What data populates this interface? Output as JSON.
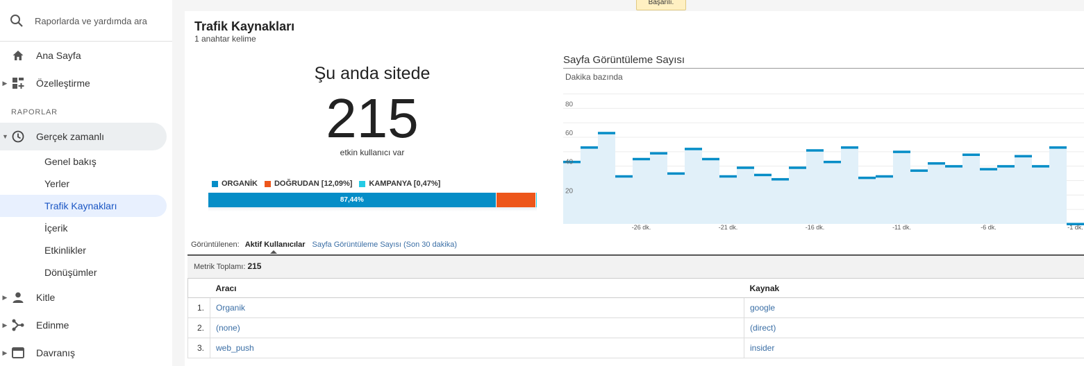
{
  "search": {
    "placeholder": "Raporlarda ve yardımda ara"
  },
  "sidebar": {
    "home": "Ana Sayfa",
    "customize": "Özelleştirme",
    "section": "RAPORLAR",
    "realtime": "Gerçek zamanlı",
    "realtime_items": [
      "Genel bakış",
      "Yerler",
      "Trafik Kaynakları",
      "İçerik",
      "Etkinlikler",
      "Dönüşümler"
    ],
    "audience": "Kitle",
    "acquisition": "Edinme",
    "behavior": "Davranış"
  },
  "toast": "Başarılı.",
  "page": {
    "title": "Trafik Kaynakları",
    "subtitle": "1 anahtar kelime"
  },
  "now": {
    "label": "Şu anda sitede",
    "count": "215",
    "caption": "etkin kullanıcı var"
  },
  "breakdown": {
    "legend": [
      {
        "label": "ORGANİK",
        "color": "#058dc7"
      },
      {
        "label": "DOĞRUDAN [12,09%]",
        "color": "#ed561b"
      },
      {
        "label": "KAMPANYA [0,47%]",
        "color": "#24cbe5"
      }
    ],
    "segments": [
      {
        "percent": 87.44,
        "text": "87,44%",
        "color": "#058dc7"
      },
      {
        "percent": 12.09,
        "text": "",
        "color": "#ed561b"
      },
      {
        "percent": 0.47,
        "text": "",
        "color": "#24cbe5"
      }
    ]
  },
  "chart_data": {
    "type": "bar",
    "title": "Sayfa Görüntüleme Sayısı",
    "subtitle": "Dakika bazında",
    "yticks": [
      20,
      40,
      60,
      80
    ],
    "ylim": [
      0,
      96
    ],
    "x_tick_labels": [
      "-26 dk.",
      "-21 dk.",
      "-16 dk.",
      "-11 dk.",
      "-6 dk.",
      "-1 dk."
    ],
    "x_tick_positions": [
      -26,
      -21,
      -16,
      -11,
      -6,
      -1
    ],
    "x": [
      -30,
      -29,
      -28,
      -27,
      -26,
      -25,
      -24,
      -23,
      -22,
      -21,
      -20,
      -19,
      -18,
      -17,
      -16,
      -15,
      -14,
      -13,
      -12,
      -11,
      -10,
      -9,
      -8,
      -7,
      -6,
      -5,
      -4,
      -3,
      -2,
      -1,
      0
    ],
    "values": [
      43,
      53,
      63,
      33,
      45,
      49,
      35,
      52,
      45,
      33,
      39,
      34,
      31,
      39,
      51,
      43,
      53,
      32,
      33,
      50,
      37,
      42,
      40,
      48,
      38,
      40,
      47,
      40,
      53,
      0,
      1
    ],
    "color": "#058dc7",
    "fill": "#e1f0f9"
  },
  "tabs": {
    "label": "Görüntülenen:",
    "active": "Aktif Kullanıcılar",
    "other": "Sayfa Görüntüleme Sayısı (Son 30 dakika)"
  },
  "metric": {
    "label": "Metrik Toplamı:",
    "value": "215"
  },
  "table": {
    "headers": [
      "Aracı",
      "Kaynak"
    ],
    "rows": [
      {
        "idx": "1.",
        "medium": "Organik",
        "source": "google"
      },
      {
        "idx": "2.",
        "medium": "(none)",
        "source": "(direct)"
      },
      {
        "idx": "3.",
        "medium": "web_push",
        "source": "insider"
      }
    ]
  }
}
